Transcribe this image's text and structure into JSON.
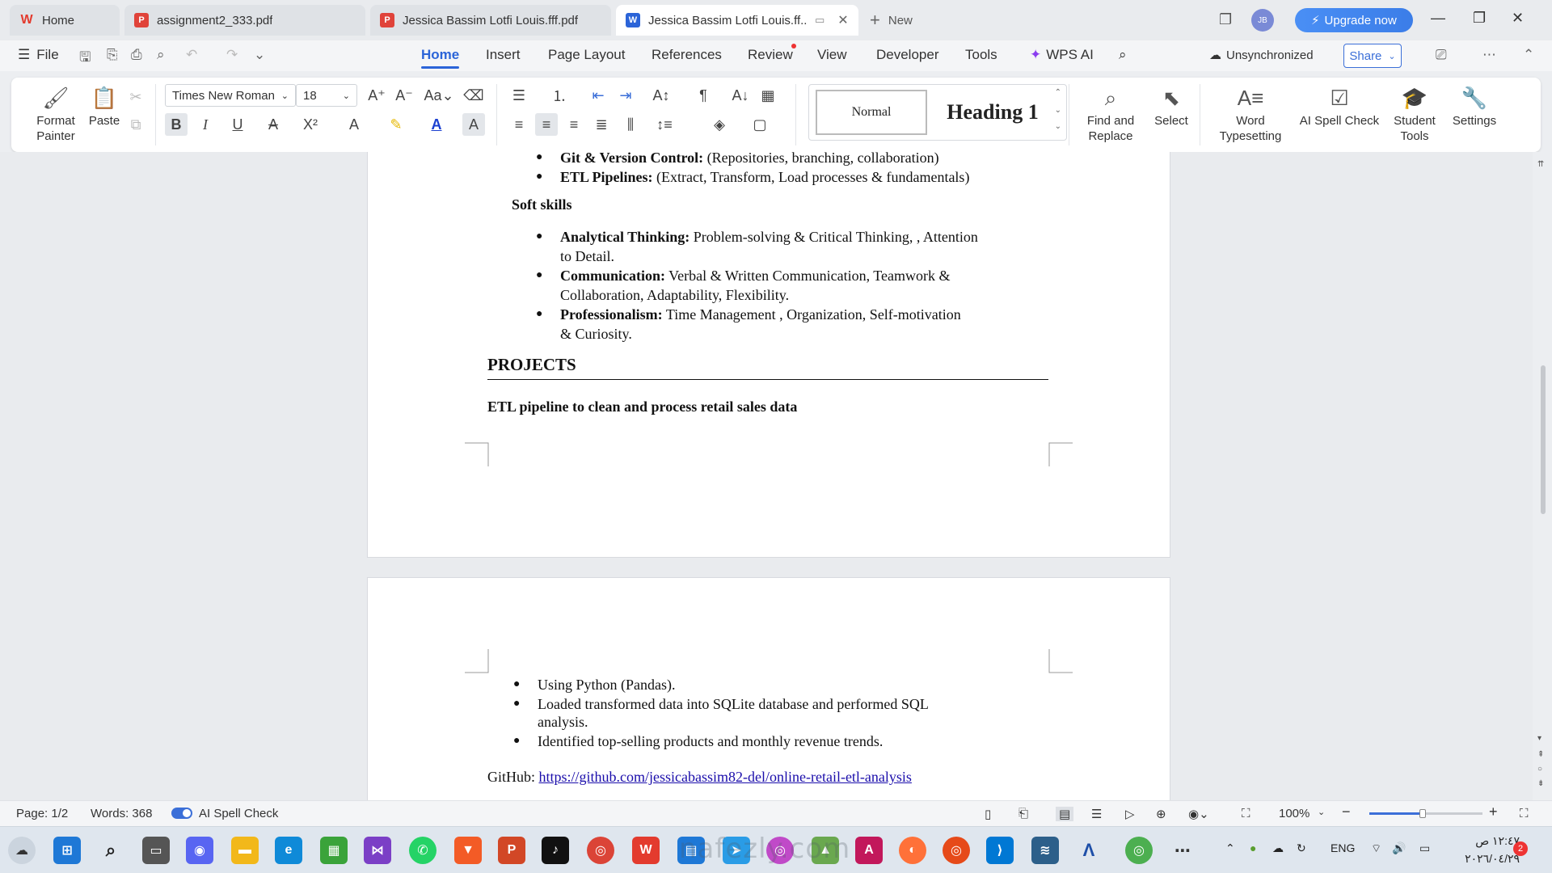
{
  "tabs": [
    {
      "label": "Home",
      "icon": "wps-logo-icon",
      "color": "#e33b2e"
    },
    {
      "label": "assignment2_333.pdf",
      "icon": "pdf-icon",
      "color": "#e0433a"
    },
    {
      "label": "Jessica Bassim Lotfi Louis.fff.pdf",
      "icon": "pdf-icon",
      "color": "#e0433a"
    },
    {
      "label": "Jessica Bassim Lotfi Louis.ff...",
      "icon": "word-icon",
      "color": "#2b64d8"
    }
  ],
  "new_tab_label": "New",
  "upgrade_label": "Upgrade now",
  "avatar_initials": "JB",
  "menu": {
    "file": "File",
    "items": [
      "Home",
      "Insert",
      "Page Layout",
      "References",
      "Review",
      "View",
      "Developer",
      "Tools"
    ],
    "wps_ai": "WPS AI",
    "unsync": "Unsynchronized",
    "share": "Share"
  },
  "ribbon": {
    "format_painter": [
      "Format",
      "Painter"
    ],
    "paste": "Paste",
    "font_name": "Times New Roman",
    "font_size": "18",
    "style_normal": "Normal",
    "style_heading": "Heading 1",
    "find_replace": [
      "Find and",
      "Replace"
    ],
    "select": "Select",
    "word_typesetting": [
      "Word",
      "Typesetting"
    ],
    "ai_spell_check": "AI Spell Check",
    "student_tools": [
      "Student",
      "Tools"
    ],
    "settings": "Settings"
  },
  "document": {
    "page1_lines": [
      {
        "bold": "Git & Version Control:",
        "text": " (Repositories, branching, collaboration)",
        "bullet": true
      },
      {
        "bold": "ETL Pipelines:",
        "text": " (Extract, Transform, Load processes & fundamentals)",
        "bullet": true
      }
    ],
    "soft_skills_heading": "Soft skills",
    "soft_skills": [
      {
        "bold": "Analytical Thinking:",
        "line1": "  Problem-solving & Critical Thinking, , Attention",
        "line2": "to Detail."
      },
      {
        "bold": "Communication:",
        "line1": "  Verbal & Written Communication, Teamwork &",
        "line2": "Collaboration, Adaptability, Flexibility."
      },
      {
        "bold": "Professionalism:",
        "line1": "  Time Management , Organization, Self-motivation",
        "line2": "& Curiosity."
      }
    ],
    "projects_heading": "PROJECTS",
    "project_title": "ETL pipeline to clean and process retail sales data",
    "page2_bullets": [
      {
        "bold_end": "Using Python (Pandas).",
        "line2": ""
      },
      {
        "bold_end": "Loaded transformed data into SQLite database and performed SQL",
        "line2": "analysis."
      },
      {
        "bold_end": "Identified top-selling products and monthly revenue trends.",
        "line2": ""
      }
    ],
    "github_label": "GitHub: ",
    "github_url": "https://github.com/jessicabassim82-del/online-retail-etl-analysis"
  },
  "status": {
    "page": "Page: 1/2",
    "words": "Words: 368",
    "spell": "AI Spell Check",
    "zoom": "100%"
  },
  "taskbar": {
    "lang": "ENG",
    "time": "١٢:٤٧ ص",
    "date": "٢٠٢٦/٠٤/٢٩",
    "notif": "2",
    "watermark": "nafezly.com"
  },
  "colors": {
    "accent": "#2b64d8",
    "link": "#1a0dab"
  }
}
